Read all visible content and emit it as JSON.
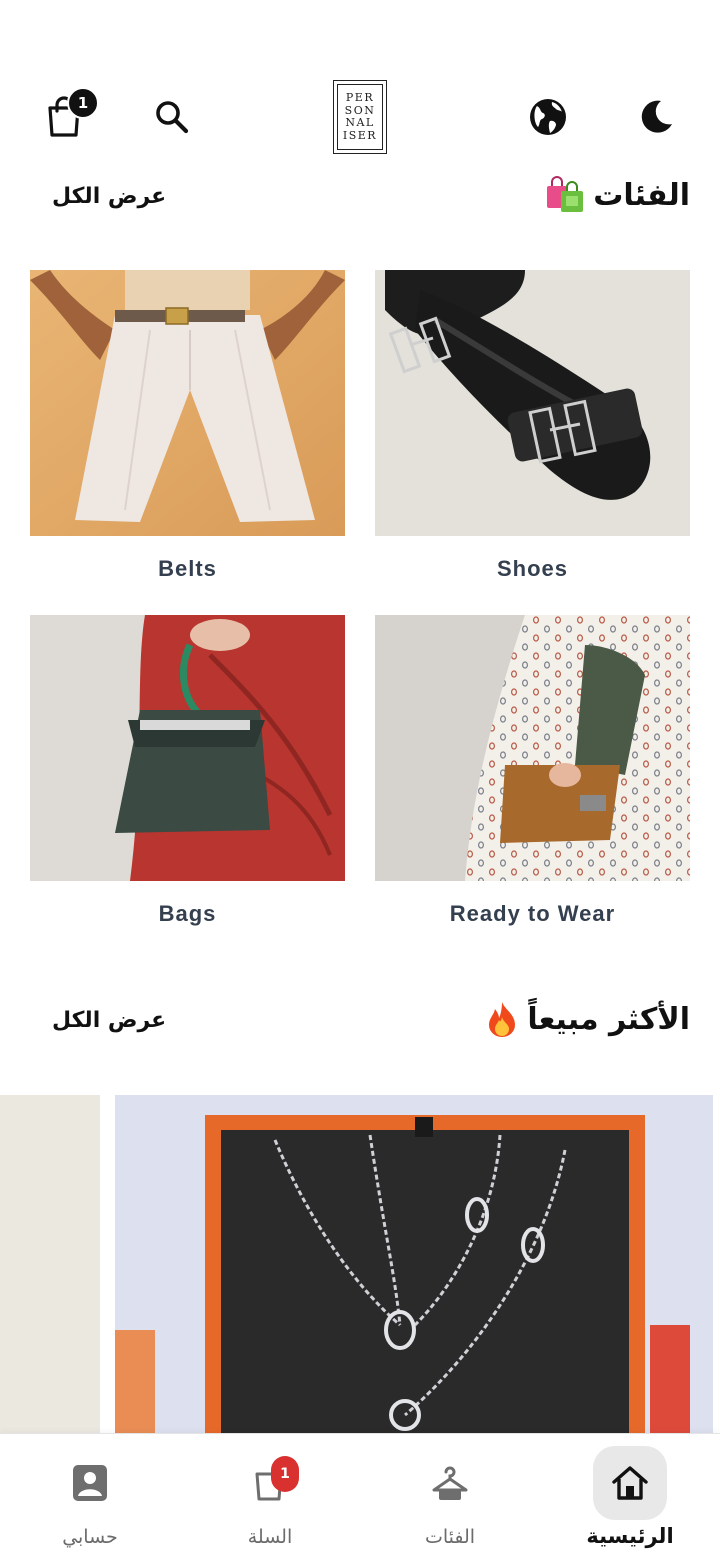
{
  "header": {
    "logo_lines": [
      "PER",
      "SON",
      "NAL",
      "ISER"
    ],
    "cart_count": "1",
    "icons": [
      "cart-icon",
      "search-icon",
      "globe-icon",
      "moon-icon"
    ]
  },
  "categories": {
    "title": "الفئات",
    "title_emoji": "🛍️",
    "see_all": "عرض الكل",
    "items": [
      {
        "label": "Shoes"
      },
      {
        "label": "Belts"
      },
      {
        "label": "Ready to Wear"
      },
      {
        "label": "Bags"
      }
    ]
  },
  "best_sellers": {
    "title": "الأكثر مبيعاً",
    "title_emoji": "🔥",
    "see_all": "عرض الكل"
  },
  "bottom_nav": {
    "items": [
      {
        "label": "الرئيسية",
        "icon": "home-icon",
        "active": true
      },
      {
        "label": "الفئات",
        "icon": "hanger-icon",
        "active": false
      },
      {
        "label": "السلة",
        "icon": "cart-icon",
        "active": false,
        "badge": "1"
      },
      {
        "label": "حسابي",
        "icon": "account-icon",
        "active": false
      }
    ]
  },
  "colors": {
    "accent_badge": "#d93030",
    "text_dark": "#111111",
    "label_slate": "#34404f"
  }
}
